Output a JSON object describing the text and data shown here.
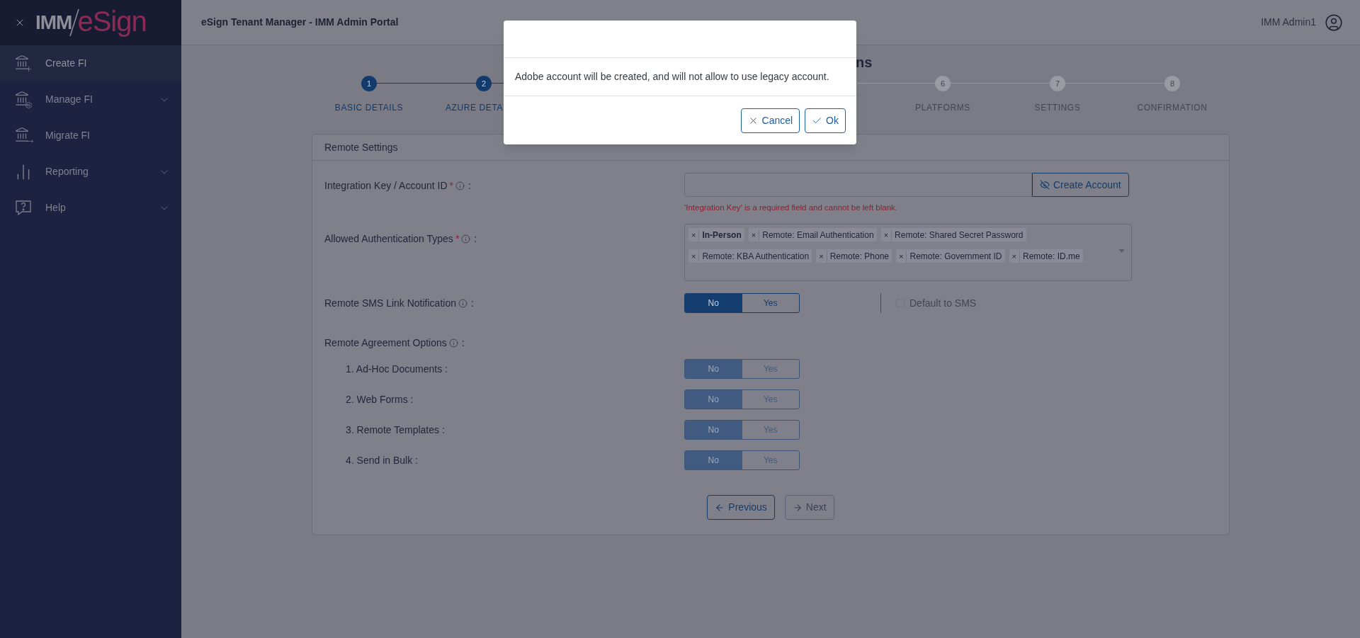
{
  "sidebar": {
    "logo": {
      "prefix": "IMM",
      "suffix": "eSign"
    },
    "items": [
      {
        "label": "Create FI",
        "selected": true,
        "expandable": false
      },
      {
        "label": "Manage FI",
        "selected": false,
        "expandable": true
      },
      {
        "label": "Migrate FI",
        "selected": false,
        "expandable": false
      },
      {
        "label": "Reporting",
        "selected": false,
        "expandable": true
      },
      {
        "label": "Help",
        "selected": false,
        "expandable": true
      }
    ]
  },
  "header": {
    "title": "eSign Tenant Manager - IMM Admin Portal",
    "user": "IMM Admin1"
  },
  "page_heading": "ns",
  "stepper": {
    "left": [
      {
        "number": "1",
        "label": "BASIC DETAILS",
        "active": true
      },
      {
        "number": "2",
        "label": "AZURE DETA",
        "active": true
      }
    ],
    "right": [
      {
        "number": "6",
        "label": "PLATFORMS",
        "active": false
      },
      {
        "number": "7",
        "label": "SETTINGS",
        "active": false
      },
      {
        "number": "8",
        "label": "CONFIRMATION",
        "active": false
      }
    ]
  },
  "card": {
    "title": "Remote Settings",
    "integration_key": {
      "label": "Integration Key / Account ID",
      "required_mark": "*",
      "suffix": ":",
      "button": "Create Account",
      "error": "'Integration Key' is a required field and cannot be left blank."
    },
    "auth_types": {
      "label": "Allowed Authentication Types",
      "required_mark": "*",
      "suffix": ":",
      "chips": [
        {
          "label": "In-Person",
          "remove": "×",
          "emphasized": true
        },
        {
          "label": "Remote: Email Authentication",
          "remove": "×",
          "emphasized": false
        },
        {
          "label": "Remote: Shared Secret Password",
          "remove": "×",
          "emphasized": false
        },
        {
          "label": "Remote: KBA Authentication",
          "remove": "×",
          "emphasized": false
        },
        {
          "label": "Remote: Phone",
          "remove": "×",
          "emphasized": false
        },
        {
          "label": "Remote: Government ID",
          "remove": "×",
          "emphasized": false
        },
        {
          "label": "Remote: ID.me",
          "remove": "×",
          "emphasized": false
        }
      ]
    },
    "sms": {
      "label": "Remote SMS Link Notification",
      "suffix": ":",
      "disabled": false,
      "options": [
        {
          "label": "No",
          "selected": true
        },
        {
          "label": "Yes",
          "selected": false
        }
      ],
      "default_to_sms": {
        "label": "Default to SMS",
        "checked": false,
        "disabled": true
      }
    },
    "agreement": {
      "label": "Remote Agreement Options",
      "suffix": ":",
      "items": [
        {
          "label": "1. Ad-Hoc Documents :",
          "disabled": true,
          "options": [
            {
              "label": "No",
              "selected": true
            },
            {
              "label": "Yes",
              "selected": false
            }
          ]
        },
        {
          "label": "2. Web Forms :",
          "disabled": true,
          "options": [
            {
              "label": "No",
              "selected": true
            },
            {
              "label": "Yes",
              "selected": false
            }
          ]
        },
        {
          "label": "3. Remote Templates :",
          "disabled": true,
          "options": [
            {
              "label": "No",
              "selected": true
            },
            {
              "label": "Yes",
              "selected": false
            }
          ]
        },
        {
          "label": "4. Send in Bulk :",
          "disabled": true,
          "options": [
            {
              "label": "No",
              "selected": true
            },
            {
              "label": "Yes",
              "selected": false
            }
          ]
        }
      ]
    },
    "buttons": [
      {
        "label": "Previous",
        "kind": "previous",
        "disabled": false
      },
      {
        "label": "Next",
        "kind": "next",
        "disabled": true
      }
    ]
  },
  "modal": {
    "message": "Adobe account will be created, and will not allow to use legacy account.",
    "buttons": [
      {
        "label": "Cancel",
        "kind": "cancel"
      },
      {
        "label": "Ok",
        "kind": "ok"
      }
    ]
  }
}
